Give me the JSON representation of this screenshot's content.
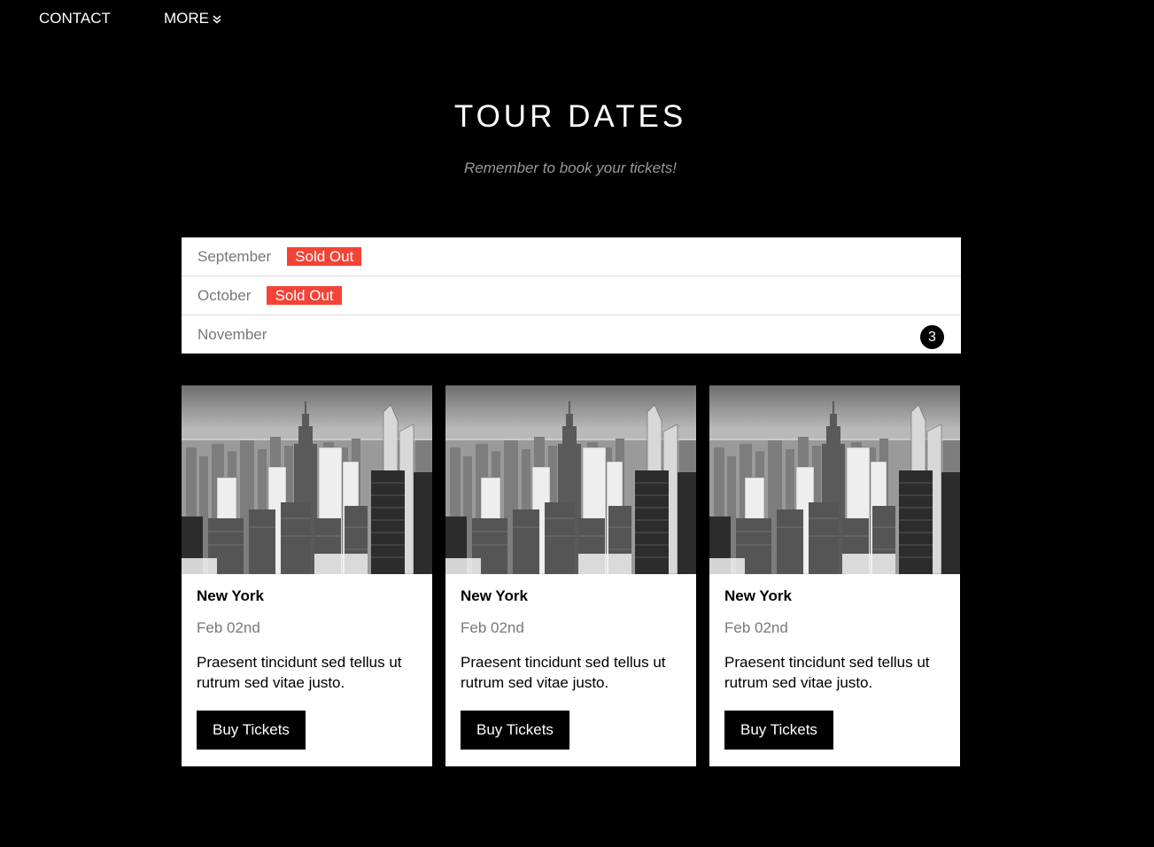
{
  "nav": {
    "contact_label": "CONTACT",
    "more_label": "MORE"
  },
  "section": {
    "title": "TOUR DATES",
    "subtitle": "Remember to book your tickets!"
  },
  "months": [
    {
      "name": "September",
      "tag": "Sold Out"
    },
    {
      "name": "October",
      "tag": "Sold Out"
    },
    {
      "name": "November",
      "count": "3"
    }
  ],
  "cards": [
    {
      "city": "New York",
      "date": "Feb 02nd",
      "description": "Praesent tincidunt sed tellus ut rutrum sed vitae justo.",
      "button_label": "Buy Tickets"
    },
    {
      "city": "New York",
      "date": "Feb 02nd",
      "description": "Praesent tincidunt sed tellus ut rutrum sed vitae justo.",
      "button_label": "Buy Tickets"
    },
    {
      "city": "New York",
      "date": "Feb 02nd",
      "description": "Praesent tincidunt sed tellus ut rutrum sed vitae justo.",
      "button_label": "Buy Tickets"
    }
  ],
  "colors": {
    "background": "#000000",
    "sold_out": "#f44336",
    "muted_text": "#777777"
  }
}
